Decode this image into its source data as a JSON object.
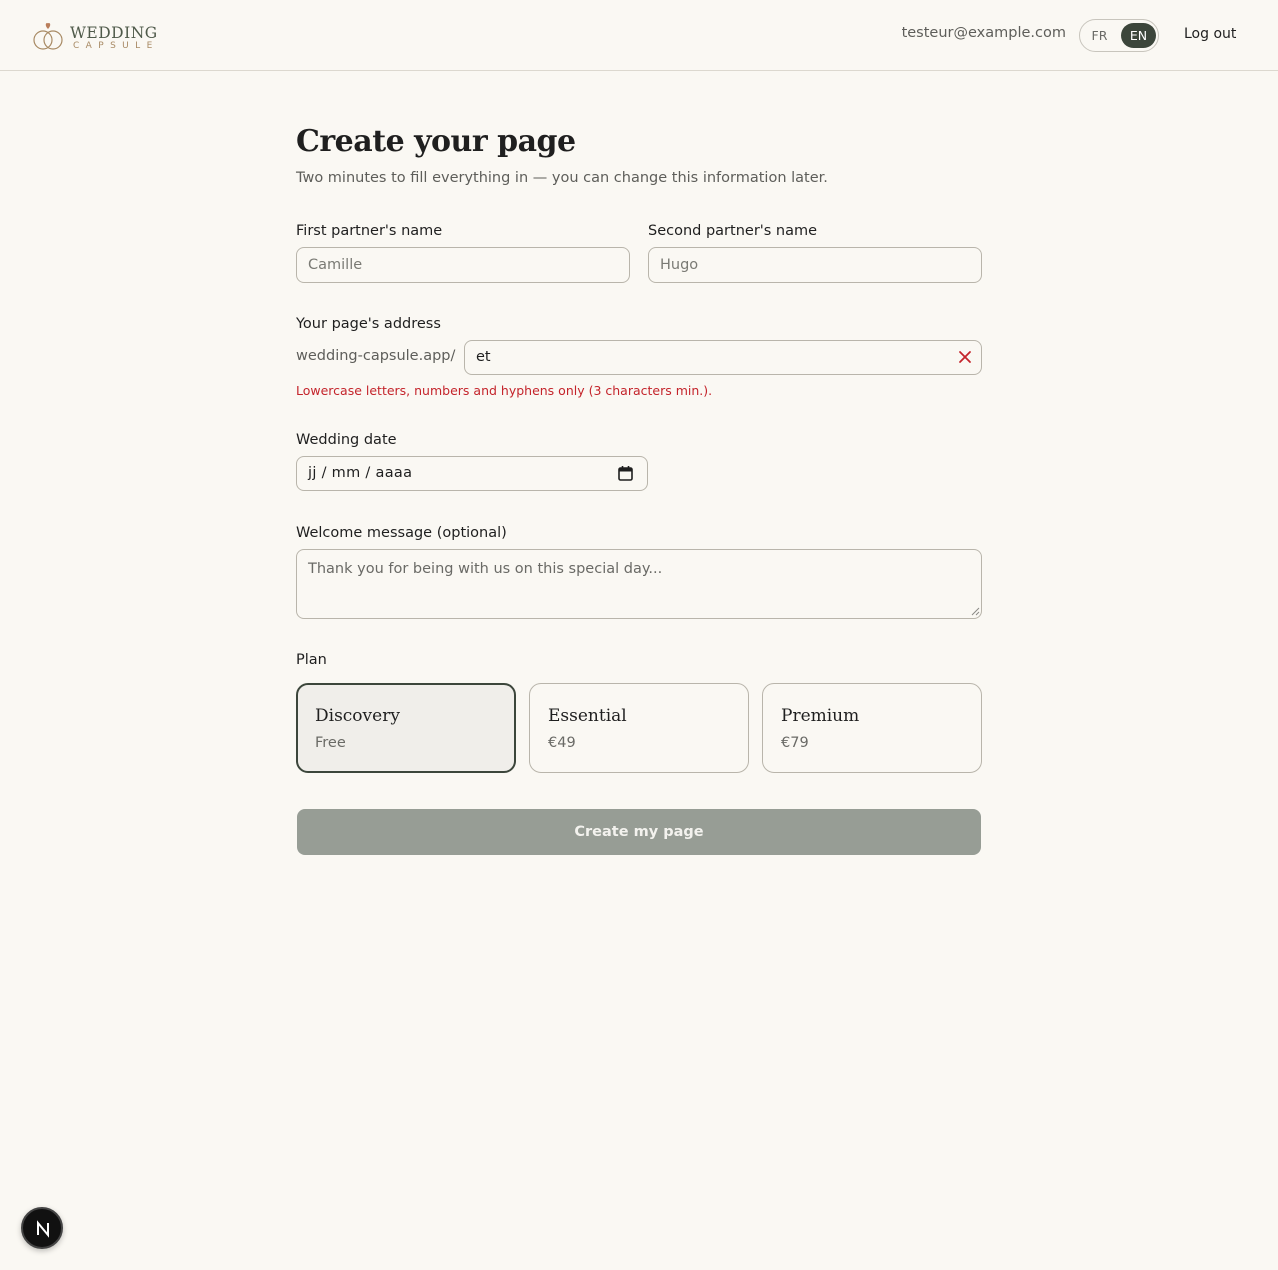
{
  "header": {
    "logo_top": "WEDDING",
    "logo_bottom": "CAPSULE",
    "user_email": "testeur@example.com",
    "lang_fr": "FR",
    "lang_en": "EN",
    "active_lang": "EN",
    "logout_label": "Log out"
  },
  "form": {
    "title": "Create your page",
    "subtitle": "Two minutes to fill everything in — you can change this information later.",
    "first_partner_label": "First partner's name",
    "first_partner_placeholder": "Camille",
    "second_partner_label": "Second partner's name",
    "second_partner_placeholder": "Hugo",
    "address_label": "Your page's address",
    "address_prefix": "wedding-capsule.app/",
    "address_value": "et",
    "address_error": "Lowercase letters, numbers and hyphens only (3 characters min.).",
    "date_label": "Wedding date",
    "date_value": "jj / mm / aaaa",
    "welcome_label": "Welcome message (optional)",
    "welcome_placeholder": "Thank you for being with us on this special day...",
    "plan_label": "Plan",
    "plans": [
      {
        "name": "Discovery",
        "price": "Free",
        "selected": true
      },
      {
        "name": "Essential",
        "price": "€49",
        "selected": false
      },
      {
        "name": "Premium",
        "price": "€79",
        "selected": false
      }
    ],
    "submit_label": "Create my page"
  },
  "dev_badge": {
    "letter": "N"
  },
  "colors": {
    "background": "#faf8f3",
    "accent_dark": "#3c463b",
    "error": "#c4242b",
    "submit_disabled": "#979d95",
    "logo_gold": "#a88a64"
  }
}
